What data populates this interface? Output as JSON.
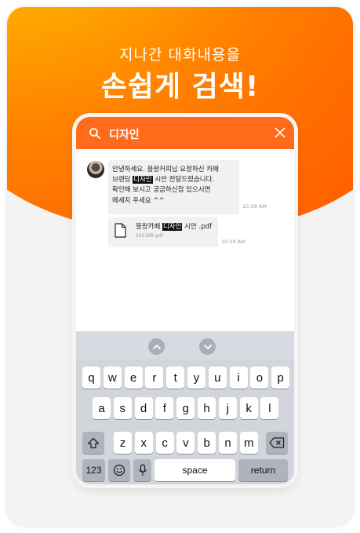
{
  "headline": {
    "sub": "지나간 대화내용을",
    "main": "손쉽게 검색!"
  },
  "search": {
    "query": "디자인"
  },
  "chat": {
    "message1": {
      "line1": "안녕하세요. 블랑커피님 요청하신 카페",
      "line2_before": "브랜딩 ",
      "line2_highlight": "디자인",
      "line2_after": " 시안 전달드렸습니다.",
      "line3": "확인해 보시고 궁금하신점 있으시면",
      "line4": "메세지 주세요 ^^",
      "time": "10:29 AM"
    },
    "file": {
      "name_before": "블랑카페 ",
      "name_highlight": "디자인",
      "name_after": " 시안 .pdf",
      "size": "5421KB pdf",
      "time": "10:29 AM"
    }
  },
  "keyboard": {
    "row1": [
      "q",
      "w",
      "e",
      "r",
      "t",
      "y",
      "u",
      "i",
      "o",
      "p"
    ],
    "row2": [
      "a",
      "s",
      "d",
      "f",
      "g",
      "h",
      "j",
      "k",
      "l"
    ],
    "row3": [
      "z",
      "x",
      "c",
      "v",
      "b",
      "n",
      "m"
    ],
    "numbers_label": "123",
    "space_label": "space",
    "return_label": "return"
  },
  "colors": {
    "accent": "#ff6b1a",
    "highlight_bg": "#111111"
  }
}
